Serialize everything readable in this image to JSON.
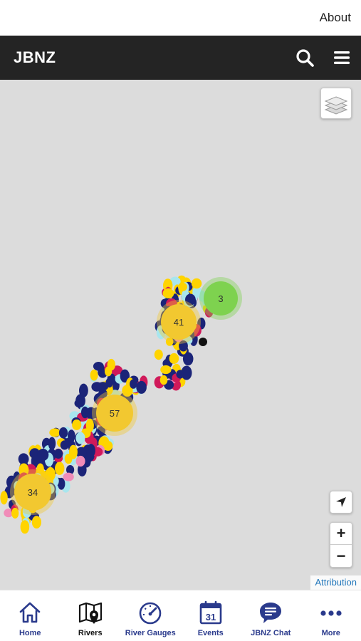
{
  "top_bar": {
    "about_label": "About"
  },
  "header": {
    "title": "JBNZ",
    "search_icon": "search-icon",
    "menu_icon": "hamburger-menu-icon",
    "background": "#242424"
  },
  "map": {
    "background": "#dcdcdc",
    "layers_icon": "layers-icon",
    "locate_icon": "location-arrow-icon",
    "zoom_in_label": "+",
    "zoom_out_label": "−",
    "attribution_label": "Attribution",
    "clusters": [
      {
        "count": "41",
        "color": "#f2c830"
      },
      {
        "count": "3",
        "color": "#7ed24f"
      },
      {
        "count": "57",
        "color": "#f2c830"
      },
      {
        "count": "34",
        "color": "#f2c830"
      }
    ],
    "marker_colors": [
      "#1b2478",
      "#ffd400",
      "#a8e6ee",
      "#d01a5a",
      "#f08cb8"
    ]
  },
  "bottom_nav": {
    "accent": "#2a3a8c",
    "items": [
      {
        "label": "Home",
        "icon": "home-icon"
      },
      {
        "label": "Rivers",
        "icon": "river-map-icon"
      },
      {
        "label": "River Gauges",
        "icon": "gauge-icon"
      },
      {
        "label": "Events",
        "icon": "calendar-icon",
        "badge": "31"
      },
      {
        "label": "JBNZ Chat",
        "icon": "chat-bubble-icon"
      },
      {
        "label": "More",
        "icon": "more-dots-icon"
      }
    ]
  }
}
